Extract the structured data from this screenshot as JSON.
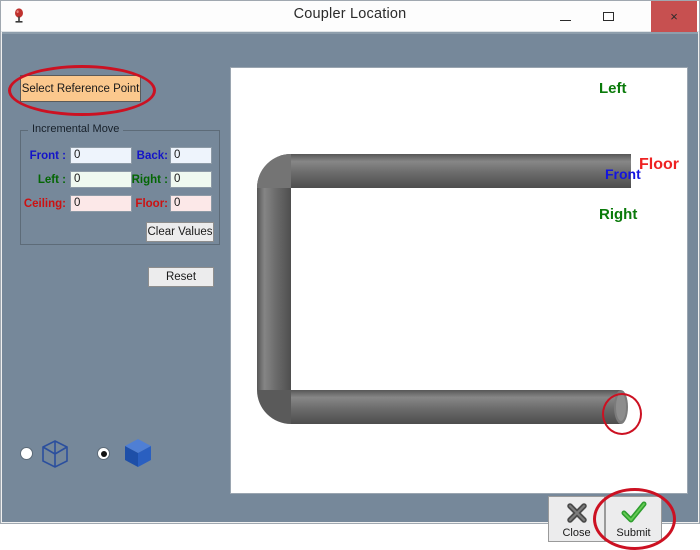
{
  "window": {
    "title": "Coupler Location",
    "app_icon": "application-icon",
    "controls": {
      "minimize": "minimize-button",
      "maximize": "maximize-button",
      "close": "close-button",
      "close_glyph": "×"
    }
  },
  "toolbar": {
    "select_reference_point": "Select Reference Point",
    "highlight_color": "#cc1122",
    "button_color": "#fbc88d"
  },
  "incremental_move": {
    "title": "Incremental Move",
    "fields": [
      {
        "label": "Front :",
        "value": "0",
        "color": "#1414c8",
        "tint": "#eef4fc"
      },
      {
        "label": "Back:",
        "value": "0",
        "color": "#1414c8",
        "tint": "#eef4fc"
      },
      {
        "label": "Left :",
        "value": "0",
        "color": "#046604",
        "tint": "#f0f9f0"
      },
      {
        "label": "Right :",
        "value": "0",
        "color": "#046604",
        "tint": "#f0f9f0"
      },
      {
        "label": "Ceiling:",
        "value": "0",
        "color": "#cc1111",
        "tint": "#fce8e8"
      },
      {
        "label": "Floor:",
        "value": "0",
        "color": "#cc1111",
        "tint": "#fce8e8"
      }
    ],
    "clear_values": "Clear Values"
  },
  "reset_button": "Reset",
  "view_modes": [
    {
      "name": "wireframe-cube",
      "selected": false
    },
    {
      "name": "solid-cube",
      "selected": true
    }
  ],
  "viewport": {
    "orientation_labels": [
      {
        "text": "Left",
        "color": "#0a7a0a"
      },
      {
        "text": "Front",
        "color": "#1414e0"
      },
      {
        "text": "Floor",
        "color": "#ee2222"
      },
      {
        "text": "Right",
        "color": "#0a7a0a"
      }
    ],
    "model": "u-shaped-pipe",
    "annotation": "coupler-end-highlight"
  },
  "bottom_buttons": {
    "close": {
      "label": "Close",
      "icon": "x-icon"
    },
    "submit": {
      "label": "Submit",
      "icon": "check-icon"
    }
  }
}
